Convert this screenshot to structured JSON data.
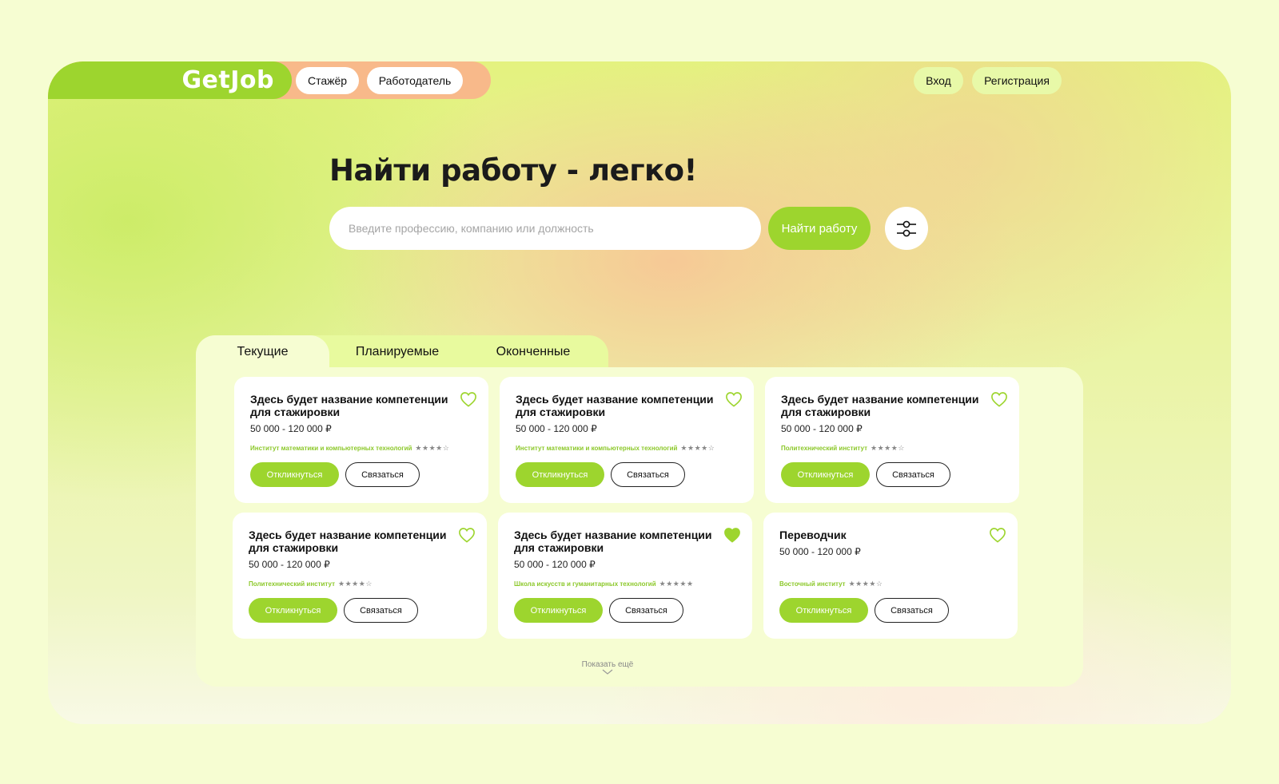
{
  "header": {
    "logo": "GetJob",
    "nav": [
      {
        "label": "Стажёр"
      },
      {
        "label": "Работодатель"
      }
    ],
    "login_label": "Вход",
    "register_label": "Регистрация"
  },
  "hero": {
    "title": "Найти работу - легко!",
    "search_placeholder": "Введите профессию, компанию или должность",
    "search_value": "",
    "search_button": "Найти работу"
  },
  "tabs": [
    {
      "label": "Текущие",
      "active": true
    },
    {
      "label": "Планируемые",
      "active": false
    },
    {
      "label": "Оконченные",
      "active": false
    }
  ],
  "cards": [
    {
      "title": "Здесь будет название компетенции для стажировки",
      "salary": "50 000 - 120 000 ₽",
      "institute": "Институт математики и компьютерных технологий",
      "rating": 4,
      "favorite": false,
      "apply": "Откликнуться",
      "contact": "Связаться"
    },
    {
      "title": "Здесь будет название компетенции для стажировки",
      "salary": "50 000 - 120 000 ₽",
      "institute": "Институт математики и компьютерных технологий",
      "rating": 4,
      "favorite": false,
      "apply": "Откликнуться",
      "contact": "Связаться"
    },
    {
      "title": "Здесь будет название компетенции для стажировки",
      "salary": "50 000 - 120 000 ₽",
      "institute": "Политехнический институт",
      "rating": 4,
      "favorite": false,
      "apply": "Откликнуться",
      "contact": "Связаться"
    },
    {
      "title": "Здесь будет название компетенции для стажировки",
      "salary": "50 000 - 120 000 ₽",
      "institute": "Политехнический институт",
      "rating": 4,
      "favorite": false,
      "apply": "Откликнуться",
      "contact": "Связаться"
    },
    {
      "title": "Здесь будет название компетенции для стажировки",
      "salary": "50 000 - 120 000 ₽",
      "institute": "Школа искусств и гуманитарных технологий",
      "rating": 5,
      "favorite": true,
      "apply": "Откликнуться",
      "contact": "Связаться"
    },
    {
      "title": "Переводчик",
      "salary": "50 000 - 120 000 ₽",
      "institute": "Восточный институт",
      "rating": 4,
      "favorite": false,
      "apply": "Откликнуться",
      "contact": "Связаться"
    }
  ],
  "show_more": "Показать ещё",
  "colors": {
    "accent": "#9dd52e",
    "peach": "#f8b98a",
    "light_green": "#e8f9a8",
    "page_bg": "#f6fdd2"
  },
  "icons": {
    "filter": "sliders-icon",
    "favorite": "heart-icon",
    "rating": "star-icon",
    "show_more": "chevron-down-icon"
  }
}
